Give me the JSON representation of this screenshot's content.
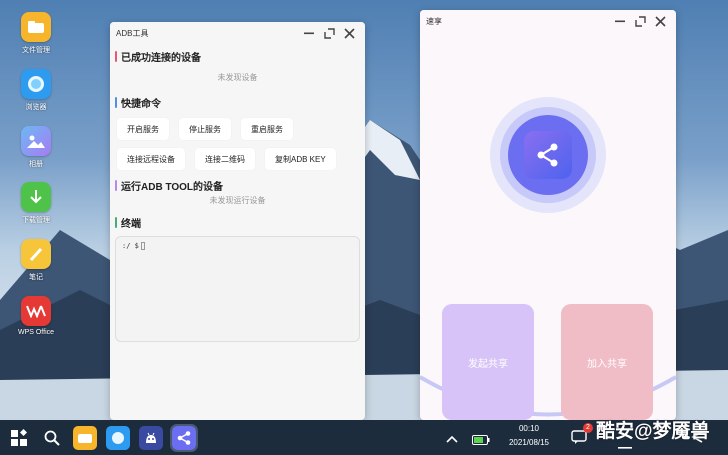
{
  "desktop": {
    "icons": [
      {
        "label": "文件管理",
        "icon": "folder-icon",
        "color": "#f6b52a"
      },
      {
        "label": "浏览器",
        "icon": "browser-icon",
        "color": "#2d9cf0"
      },
      {
        "label": "相册",
        "icon": "gallery-icon",
        "color": "#6c7cf0"
      },
      {
        "label": "下载管理",
        "icon": "download-icon",
        "color": "#4fc24a"
      },
      {
        "label": "笔记",
        "icon": "notes-icon",
        "color": "#f6c53a"
      },
      {
        "label": "WPS Office",
        "icon": "wps-icon",
        "color": "#e53935"
      }
    ]
  },
  "adb_window": {
    "title": "ADB工具",
    "connected": {
      "heading": "已成功连接的设备",
      "empty": "未发现设备",
      "accent": "#e45a76"
    },
    "quick": {
      "heading": "快捷命令",
      "accent": "#4f8fe8",
      "row1": [
        "开启服务",
        "停止服务",
        "重启服务"
      ],
      "row2": [
        "连接远程设备",
        "连接二维码",
        "复制ADB KEY"
      ]
    },
    "running": {
      "heading": "运行ADB TOOL的设备",
      "empty": "未发现运行设备",
      "accent": "#b38be8"
    },
    "terminal": {
      "heading": "终端",
      "prompt": ":/ $",
      "accent": "#4aaa7a"
    }
  },
  "share_window": {
    "title": "速享",
    "start_label": "发起共享",
    "join_label": "加入共享",
    "start_color": "#d7c3f7",
    "join_color": "#f0bcc6",
    "ring_color": "#6b6ef0"
  },
  "taskbar": {
    "time": "00:10",
    "date": "2021/08/15",
    "notification_count": "2"
  },
  "watermark": "酷安@梦魇兽"
}
